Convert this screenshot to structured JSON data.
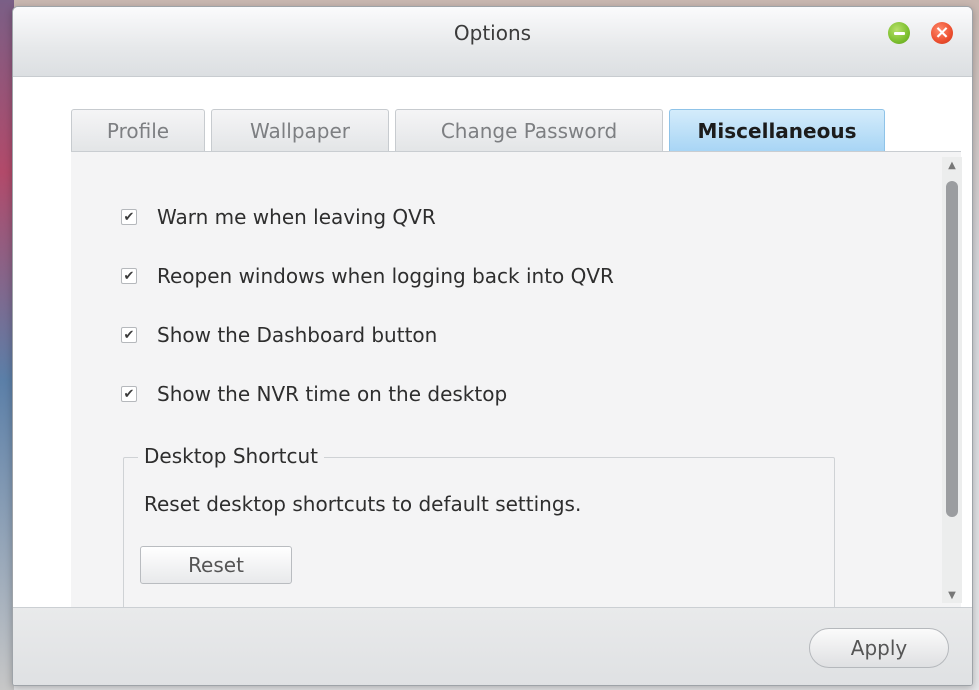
{
  "window": {
    "title": "Options",
    "minimize_symbol": "",
    "close_symbol": "×"
  },
  "tabs": [
    {
      "label": "Profile",
      "active": false
    },
    {
      "label": "Wallpaper",
      "active": false
    },
    {
      "label": "Change Password",
      "active": false
    },
    {
      "label": "Miscellaneous",
      "active": true
    }
  ],
  "options": [
    {
      "label": "Warn me when leaving QVR",
      "checked": true
    },
    {
      "label": "Reopen windows when logging back into QVR",
      "checked": true
    },
    {
      "label": "Show the Dashboard button",
      "checked": true
    },
    {
      "label": "Show the NVR time on the desktop",
      "checked": true
    }
  ],
  "checkmark_glyph": "✔",
  "desktop_shortcut": {
    "legend": "Desktop Shortcut",
    "description": "Reset desktop shortcuts to default settings.",
    "reset_label": "Reset"
  },
  "scrollbar": {
    "up_glyph": "▲",
    "down_glyph": "▼"
  },
  "footer": {
    "apply_label": "Apply"
  },
  "colors": {
    "active_tab": "#a8d5f5",
    "minimize_button": "#7cbf2e",
    "close_button": "#ec4f2f"
  }
}
